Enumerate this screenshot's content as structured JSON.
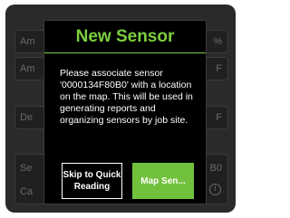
{
  "background": {
    "row1_left": "Am",
    "row1_right": "%",
    "row2_left": "Am",
    "row2_right": "F",
    "row3_left": "De",
    "row3_right": "F",
    "row4_left_top": "Se",
    "row4_right_top": "B0",
    "row4_left_bottom": "Ca",
    "info_icon_glyph": "i"
  },
  "dialog": {
    "title": "New Sensor",
    "message": "Please associate sensor '0000134F80B0' with a location on the map. This will be used in generating reports and organizing sensors by job site.",
    "skip_label": "Skip to Quick Reading",
    "map_label": "Map Sen..."
  },
  "colors": {
    "accent": "#7ccf3e",
    "button_primary": "#72c13d",
    "dialog_bg": "#000000",
    "panel_bg": "#2a2a2a"
  }
}
